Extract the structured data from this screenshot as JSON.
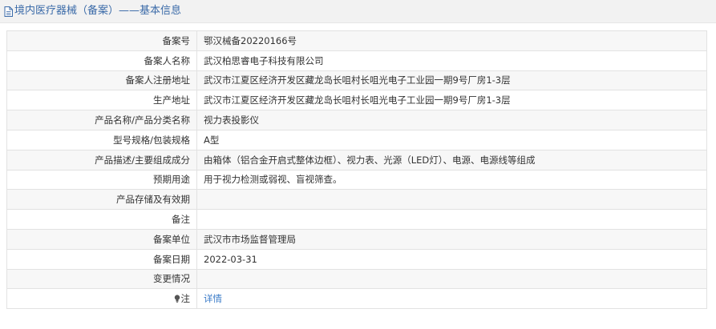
{
  "header": {
    "title": "境内医疗器械（备案）——基本信息",
    "icon": "document-icon"
  },
  "rows": [
    {
      "label": "备案号",
      "value": "鄂汉械备20220166号"
    },
    {
      "label": "备案人名称",
      "value": "武汉柏思睿电子科技有限公司"
    },
    {
      "label": "备案人注册地址",
      "value": "武汉市江夏区经济开发区藏龙岛长咀村长咀光电子工业园一期9号厂房1-3层"
    },
    {
      "label": "生产地址",
      "value": "武汉市江夏区经济开发区藏龙岛长咀村长咀光电子工业园一期9号厂房1-3层"
    },
    {
      "label": "产品名称/产品分类名称",
      "value": "视力表投影仪"
    },
    {
      "label": "型号规格/包装规格",
      "value": "A型"
    },
    {
      "label": "产品描述/主要组成成分",
      "value": "由箱体（铝合金开启式整体边框）、视力表、光源（LED灯）、电源、电源线等组成"
    },
    {
      "label": "预期用途",
      "value": "用于视力检测或弱视、盲视筛查。"
    },
    {
      "label": "产品存储及有效期",
      "value": ""
    },
    {
      "label": "备注",
      "value": ""
    },
    {
      "label": "备案单位",
      "value": "武汉市市场监督管理局"
    },
    {
      "label": "备案日期",
      "value": "2022-03-31"
    },
    {
      "label": "变更情况",
      "value": ""
    }
  ],
  "note": {
    "label": "注",
    "icon": "lightbulb-icon",
    "link_text": "详情"
  },
  "colors": {
    "title": "#3a6aa8",
    "link": "#3a7bc8",
    "row_alt": "#f7f7f7",
    "border": "#e2e2e2"
  }
}
